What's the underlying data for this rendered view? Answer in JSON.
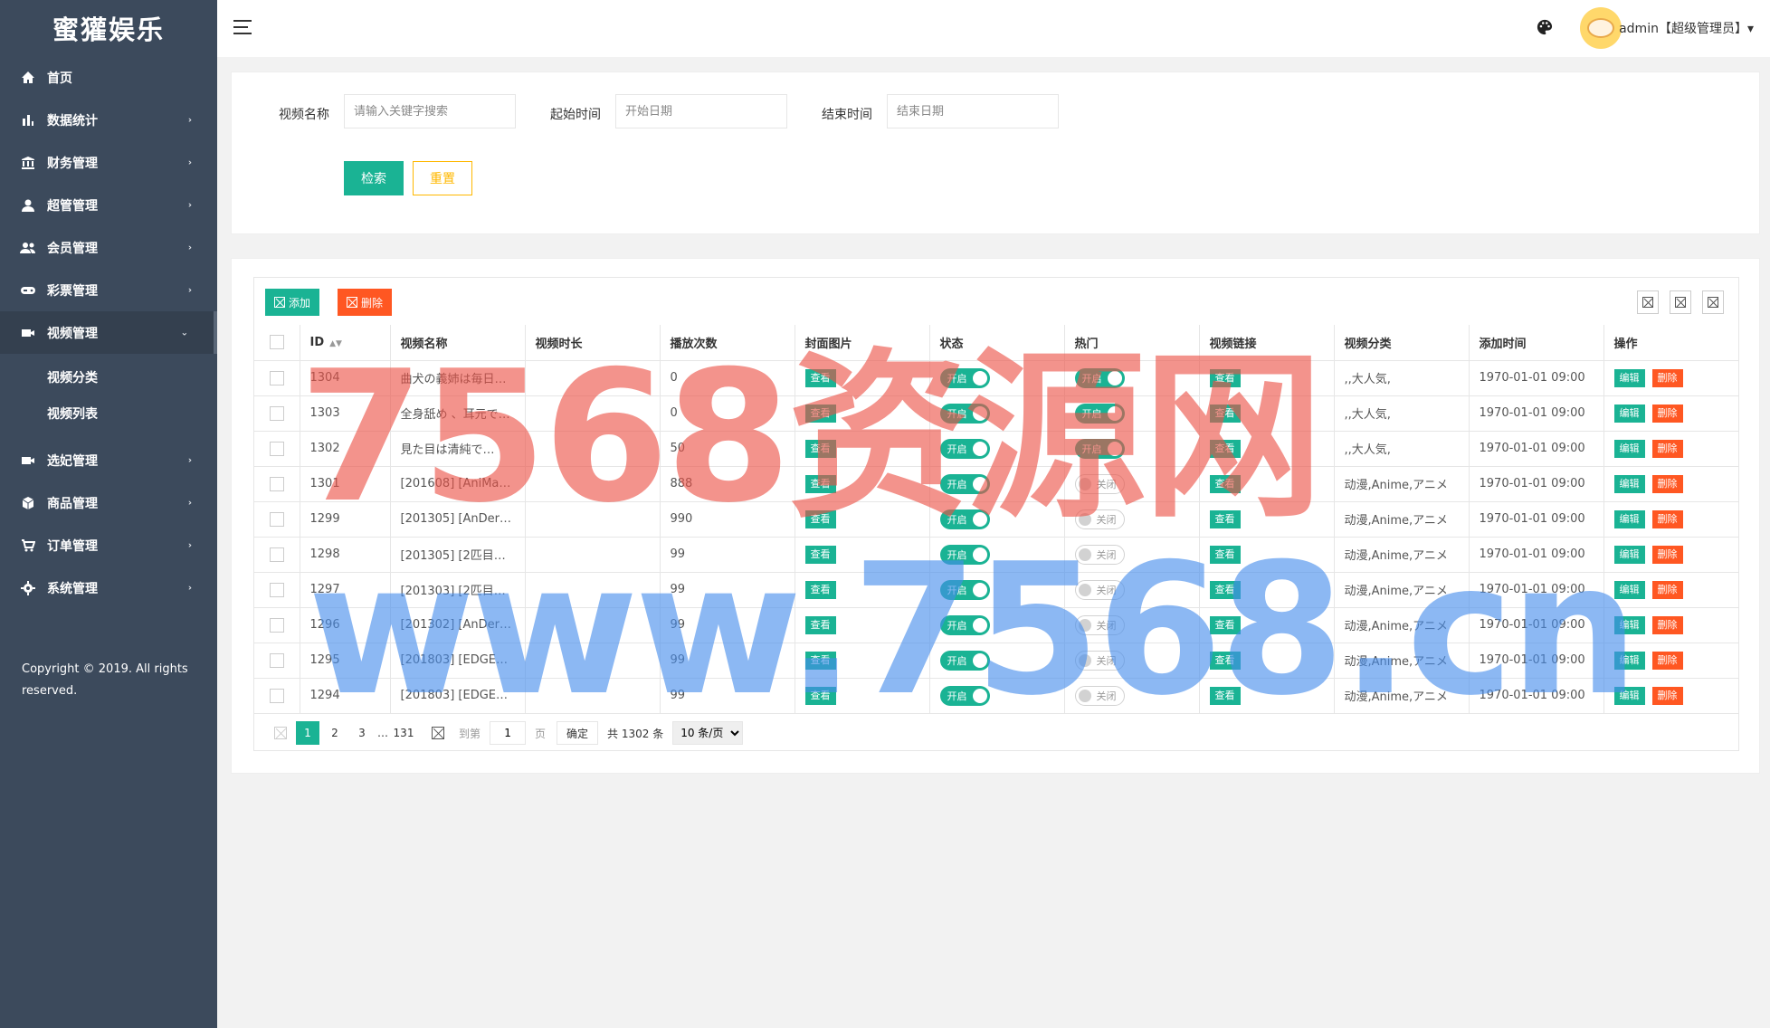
{
  "app": {
    "title": "蜜獾娱乐"
  },
  "sidebar": {
    "items": [
      {
        "label": "首页",
        "icon": "home-icon",
        "arrow": ""
      },
      {
        "label": "数据统计",
        "icon": "bar-chart-icon",
        "arrow": "›"
      },
      {
        "label": "财务管理",
        "icon": "bank-icon",
        "arrow": "›"
      },
      {
        "label": "超管管理",
        "icon": "user-icon",
        "arrow": "›"
      },
      {
        "label": "会员管理",
        "icon": "users-icon",
        "arrow": "›"
      },
      {
        "label": "彩票管理",
        "icon": "gamepad-icon",
        "arrow": "›"
      },
      {
        "label": "视频管理",
        "icon": "video-icon",
        "arrow": "⌄"
      },
      {
        "label": "选妃管理",
        "icon": "video-icon",
        "arrow": "›"
      },
      {
        "label": "商品管理",
        "icon": "box-icon",
        "arrow": "›"
      },
      {
        "label": "订单管理",
        "icon": "cart-icon",
        "arrow": "›"
      },
      {
        "label": "系统管理",
        "icon": "gear-icon",
        "arrow": "›"
      }
    ],
    "sub_items": [
      "视频分类",
      "视频列表"
    ],
    "copyright": "Copyright © 2019. All rights reserved."
  },
  "header": {
    "user_label": "admin【超级管理员】▾"
  },
  "search": {
    "name_label": "视频名称",
    "name_placeholder": "请输入关键字搜索",
    "start_label": "起始时间",
    "start_placeholder": "开始日期",
    "end_label": "结束时间",
    "end_placeholder": "结束日期",
    "search_btn": "检索",
    "reset_btn": "重置"
  },
  "toolbar": {
    "add_label": "添加",
    "delete_label": "删除"
  },
  "table": {
    "columns": [
      "ID",
      "视频名称",
      "视频时长",
      "播放次数",
      "封面图片",
      "状态",
      "热门",
      "视频链接",
      "视频分类",
      "添加时间",
      "操作"
    ],
    "rows": [
      {
        "id": "1304",
        "name": "曲犬の義姉は毎日…",
        "duration": "",
        "plays": "0",
        "cover": "查看",
        "status": "开启",
        "hot": "开启",
        "link": "查看",
        "category": ",,大人気,",
        "time": "1970-01-01 09:00"
      },
      {
        "id": "1303",
        "name": "全身舐め 、耳元で…",
        "duration": "",
        "plays": "0",
        "cover": "查看",
        "status": "开启",
        "hot": "开启",
        "link": "查看",
        "category": ",,大人気,",
        "time": "1970-01-01 09:00"
      },
      {
        "id": "1302",
        "name": "見た目は清純で…",
        "duration": "",
        "plays": "50",
        "cover": "查看",
        "status": "开启",
        "hot": "开启",
        "link": "查看",
        "category": ",,大人気,",
        "time": "1970-01-01 09:00"
      },
      {
        "id": "1301",
        "name": "[201608] [AniMan…",
        "duration": "",
        "plays": "888",
        "cover": "查看",
        "status": "开启",
        "hot": "关闭",
        "link": "查看",
        "category": "动漫,Anime,アニメ",
        "time": "1970-01-01 09:00"
      },
      {
        "id": "1299",
        "name": "[201305] [AnDer…",
        "duration": "",
        "plays": "990",
        "cover": "查看",
        "status": "开启",
        "hot": "关闭",
        "link": "查看",
        "category": "动漫,Anime,アニメ",
        "time": "1970-01-01 09:00"
      },
      {
        "id": "1298",
        "name": "[201305] [2匹目…",
        "duration": "",
        "plays": "99",
        "cover": "查看",
        "status": "开启",
        "hot": "关闭",
        "link": "查看",
        "category": "动漫,Anime,アニメ",
        "time": "1970-01-01 09:00"
      },
      {
        "id": "1297",
        "name": "[201303] [2匹目…",
        "duration": "",
        "plays": "99",
        "cover": "查看",
        "status": "开启",
        "hot": "关闭",
        "link": "查看",
        "category": "动漫,Anime,アニメ",
        "time": "1970-01-01 09:00"
      },
      {
        "id": "1296",
        "name": "[201302] [AnDer…",
        "duration": "",
        "plays": "99",
        "cover": "查看",
        "status": "开启",
        "hot": "关闭",
        "link": "查看",
        "category": "动漫,Anime,アニメ",
        "time": "1970-01-01 09:00"
      },
      {
        "id": "1295",
        "name": "[201803] [EDGE…",
        "duration": "",
        "plays": "99",
        "cover": "查看",
        "status": "开启",
        "hot": "关闭",
        "link": "查看",
        "category": "动漫,Anime,アニメ",
        "time": "1970-01-01 09:00"
      },
      {
        "id": "1294",
        "name": "[201803] [EDGE…",
        "duration": "",
        "plays": "99",
        "cover": "查看",
        "status": "开启",
        "hot": "关闭",
        "link": "查看",
        "category": "动漫,Anime,アニメ",
        "time": "1970-01-01 09:00"
      }
    ],
    "edit_label": "编辑",
    "delete_label": "删除"
  },
  "pagination": {
    "pages": [
      "1",
      "2",
      "3",
      "…",
      "131"
    ],
    "goto_label": "到第",
    "goto_value": "1",
    "page_unit": "页",
    "confirm_label": "确定",
    "total_label": "共 1302 条",
    "limit_option": "10 条/页"
  },
  "watermark": {
    "line1": "7568资源网",
    "line2": "www.7568.cn"
  },
  "colors": {
    "primary": "#1ab394",
    "danger": "#ff5722",
    "warning": "#ffb800",
    "sidebar": "#3c4a5c"
  }
}
